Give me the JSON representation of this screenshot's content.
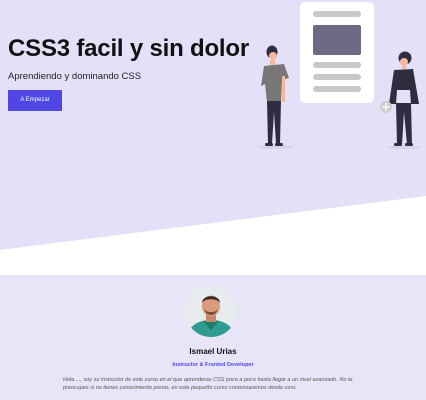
{
  "hero": {
    "title": "CSS3 facil y sin dolor",
    "subtitle": "Aprendiendo y dominando CSS",
    "cta_label": "A Empezar"
  },
  "profile": {
    "name": "Ismael Urias",
    "role": "Instructor & Fronted Developer",
    "bio": "Hola...., soy su instructor de este curso en el que aprenderas CSS poco a poco hasta llegar a un nivel avanzado. No te preocupes si no tienes conocimiento previo, en este pequeño curso comenzaremos desde cero."
  },
  "colors": {
    "accent": "#4f46e5",
    "hero_background": "#e4e0f8",
    "page_background": "#e9e5f8"
  }
}
